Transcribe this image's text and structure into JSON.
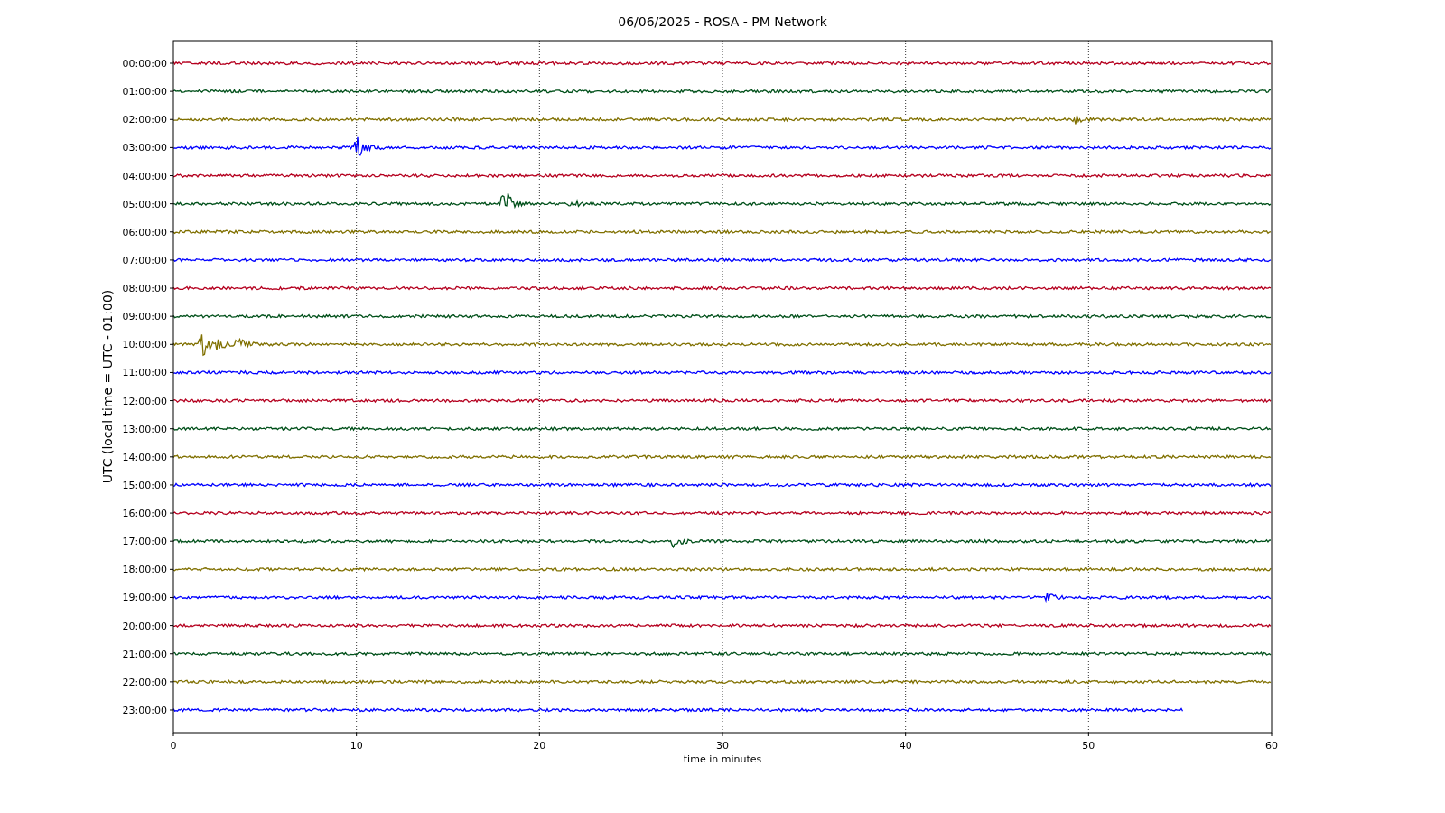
{
  "title": "06/06/2025 - ROSA - PM Network",
  "ylabel": "UTC (local time = UTC - 01:00)",
  "xlabel": "time in minutes",
  "xticks": [
    "0",
    "10",
    "20",
    "30",
    "40",
    "50",
    "60"
  ],
  "traces": [
    {
      "label": "00:00:00",
      "color": "#b5001f",
      "level": 1
    },
    {
      "label": "01:00:00",
      "color": "#00501a",
      "level": 1
    },
    {
      "label": "02:00:00",
      "color": "#807000",
      "level": 1
    },
    {
      "label": "03:00:00",
      "color": "#0000ff",
      "level": 1
    },
    {
      "label": "04:00:00",
      "color": "#b5001f",
      "level": 1
    },
    {
      "label": "05:00:00",
      "color": "#00501a",
      "level": 1
    },
    {
      "label": "06:00:00",
      "color": "#807000",
      "level": 1
    },
    {
      "label": "07:00:00",
      "color": "#0000ff",
      "level": 1
    },
    {
      "label": "08:00:00",
      "color": "#b5001f",
      "level": 1
    },
    {
      "label": "09:00:00",
      "color": "#00501a",
      "level": 1
    },
    {
      "label": "10:00:00",
      "color": "#807000",
      "level": 1
    },
    {
      "label": "11:00:00",
      "color": "#0000ff",
      "level": 1
    },
    {
      "label": "12:00:00",
      "color": "#b5001f",
      "level": 1
    },
    {
      "label": "13:00:00",
      "color": "#00501a",
      "level": 1
    },
    {
      "label": "14:00:00",
      "color": "#807000",
      "level": 1
    },
    {
      "label": "15:00:00",
      "color": "#0000ff",
      "level": 1
    },
    {
      "label": "16:00:00",
      "color": "#b5001f",
      "level": 1
    },
    {
      "label": "17:00:00",
      "color": "#00501a",
      "level": 1
    },
    {
      "label": "18:00:00",
      "color": "#807000",
      "level": 1
    },
    {
      "label": "19:00:00",
      "color": "#0000ff",
      "level": 1
    },
    {
      "label": "20:00:00",
      "color": "#b5001f",
      "level": 1
    },
    {
      "label": "21:00:00",
      "color": "#00501a",
      "level": 1
    },
    {
      "label": "22:00:00",
      "color": "#807000",
      "level": 1
    },
    {
      "label": "23:00:00",
      "color": "#0000ff",
      "level": 0.92
    }
  ]
}
